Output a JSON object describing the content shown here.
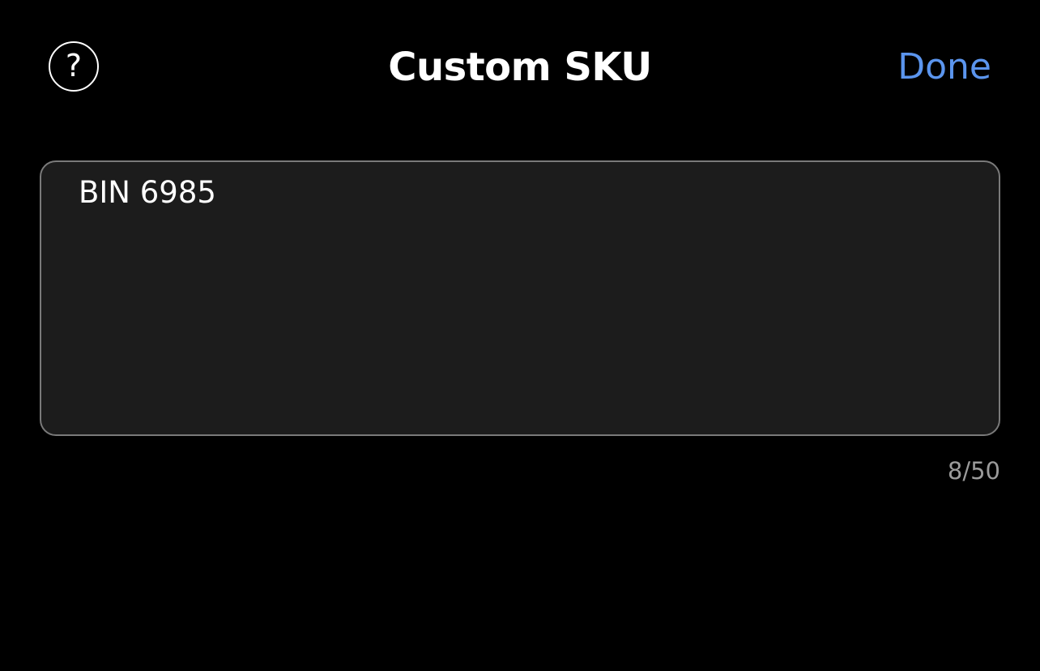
{
  "header": {
    "help_icon": "question-circle-icon",
    "help_glyph": "?",
    "title": "Custom SKU",
    "done_label": "Done"
  },
  "sku_field": {
    "value": "BIN 6985",
    "placeholder": ""
  },
  "char_count": "8/50",
  "colors": {
    "background": "#000000",
    "field_background": "#1c1c1c",
    "field_border": "#7a7a7a",
    "accent": "#5b95ee",
    "counter_text": "#9b9b9b"
  }
}
